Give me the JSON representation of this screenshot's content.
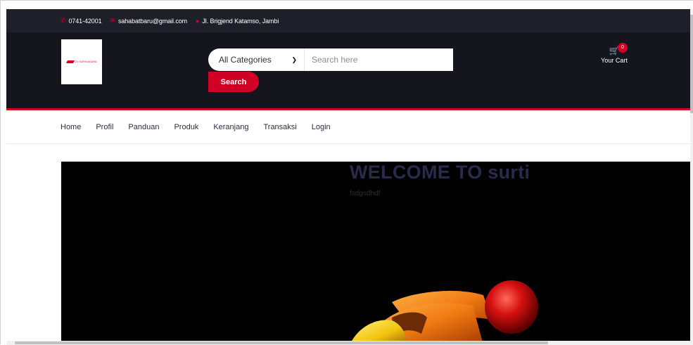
{
  "topbar": {
    "phone": "0741-42001",
    "email": "sahabatbaru@gmail.com",
    "address": "Jl. Brigjend Katamso, Jambi",
    "phone_icon": "phone-icon",
    "email_icon": "envelope-icon",
    "address_icon": "map-marker-icon"
  },
  "header": {
    "logo_text": "CV SURYA AGUNG",
    "category_selected": "All Categories",
    "search_placeholder": "Search here",
    "search_button": "Search",
    "cart_count": "0",
    "cart_label": "Your Cart",
    "cart_icon": "shopping-cart-icon"
  },
  "nav": {
    "items": [
      "Home",
      "Profil",
      "Panduan",
      "Produk",
      "Keranjang",
      "Transaksi",
      "Login"
    ]
  },
  "hero": {
    "title": "WELCOME TO surti",
    "subtitle": "fsdgsdhdf",
    "extra": "."
  },
  "colors": {
    "accent": "#d10024",
    "topbar_bg": "#1e1f29",
    "header_bg": "#15161d",
    "hero_bg": "#000000"
  }
}
